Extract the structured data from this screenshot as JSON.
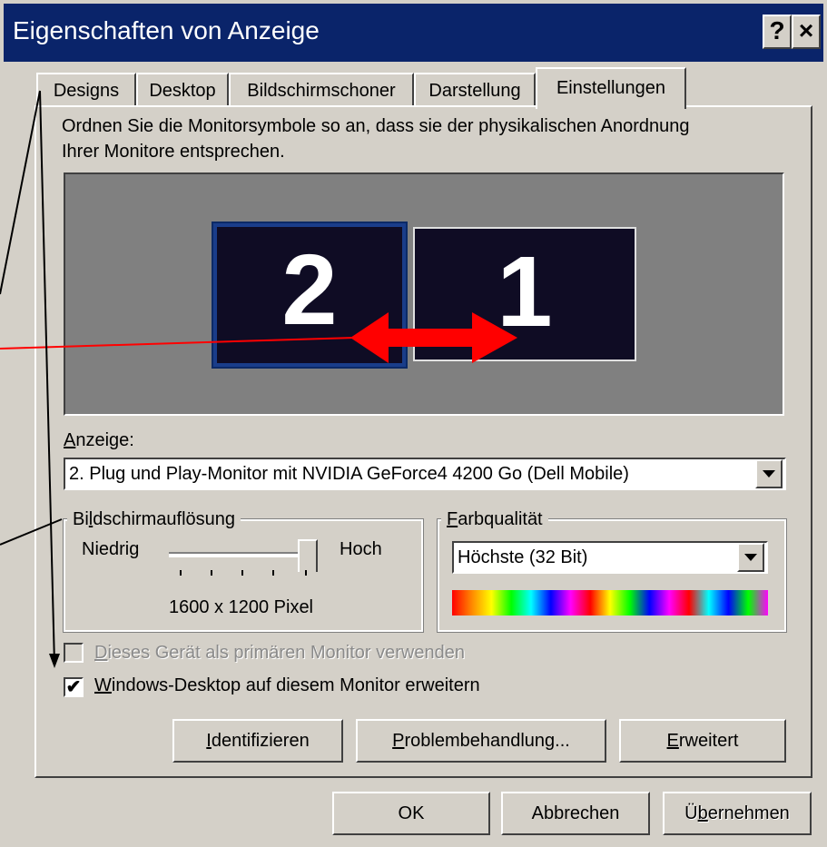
{
  "window": {
    "title": "Eigenschaften von Anzeige",
    "help_button": "?",
    "close_button": "×"
  },
  "tabs": [
    {
      "label": "Designs"
    },
    {
      "label": "Desktop"
    },
    {
      "label": "Bildschirmschoner"
    },
    {
      "label": "Darstellung"
    },
    {
      "label": "Einstellungen",
      "active": true
    }
  ],
  "instructions": {
    "line1": "Ordnen Sie die Monitorsymbole so an, dass sie der physikalischen Anordnung",
    "line2": "Ihrer Monitore entsprechen."
  },
  "monitors": [
    {
      "number": "2"
    },
    {
      "number": "1"
    }
  ],
  "display": {
    "label": "Anzeige:",
    "selected": "2. Plug und Play-Monitor mit NVIDIA GeForce4 4200 Go (Dell Mobile)"
  },
  "resolution": {
    "group_label": "Bildschirmauflösung",
    "low_label": "Niedrig",
    "high_label": "Hoch",
    "value_text": "1600 x 1200 Pixel",
    "slider_fraction": 1.0
  },
  "color_quality": {
    "group_label": "Farbqualität",
    "selected": "Höchste (32 Bit)"
  },
  "checkboxes": {
    "primary": {
      "label": "Dieses Gerät als primären Monitor verwenden",
      "checked": false,
      "enabled": false
    },
    "extend": {
      "label": "Windows-Desktop auf diesem Monitor erweitern",
      "checked": true,
      "enabled": true
    }
  },
  "panel_buttons": {
    "identify": "Identifizieren",
    "troubleshoot": "Problembehandlung...",
    "advanced": "Erweitert"
  },
  "dialog_buttons": {
    "ok": "OK",
    "cancel": "Abbrechen",
    "apply": "Übernehmen"
  },
  "colors": {
    "titlebar": "#0a246a",
    "face": "#d4d0c8",
    "monitor_bg": "#808080",
    "annotation_arrow": "#ff0000"
  }
}
